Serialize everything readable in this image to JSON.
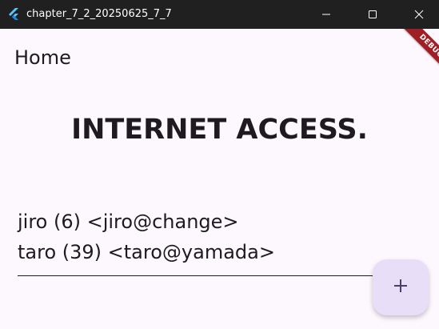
{
  "window": {
    "title": "chapter_7_2_20250625_7_7",
    "app_icon": "flutter-logo-icon",
    "controls": [
      "minimize-icon",
      "maximize-icon",
      "close-icon"
    ]
  },
  "debug_banner": {
    "label": "DEBUG",
    "color": "#a01f25"
  },
  "appbar": {
    "title": "Home"
  },
  "main": {
    "heading": "INTERNET ACCESS.",
    "items": [
      {
        "label": "jiro (6)  <jiro@change>"
      },
      {
        "label": "taro (39)  <taro@yamada>"
      }
    ]
  },
  "fab": {
    "icon": "add-icon",
    "color": "#e9def8"
  },
  "colors": {
    "background": "#fdf7fe",
    "titlebar": "#202020",
    "text": "#1d1b20",
    "accent": "#4a3f6b"
  }
}
